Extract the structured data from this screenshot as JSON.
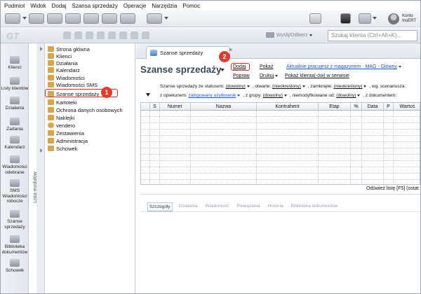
{
  "menubar": [
    "Podmiot",
    "Widok",
    "Dodaj",
    "Szansa sprzedaży",
    "Operacje",
    "Narzędzia",
    "Pomoc"
  ],
  "account": {
    "line1": "Konto",
    "line2": "InsERT"
  },
  "toolbar": {
    "send_label": "Wyślij/Odbierz",
    "search_placeholder": "Szukaj klienta (Ctrl+Alt+K)..."
  },
  "rail": {
    "items": [
      "Klienci",
      "Listy klientów",
      "Działania",
      "Zadania",
      "Kalendarz",
      "Wiadomości odebrane",
      "SMS Wiadomości robocze",
      "Szanse sprzedaży",
      "Biblioteka dokumentów",
      "Schowek"
    ],
    "vertical_label": "Lista modułów"
  },
  "tree": {
    "items": [
      "Strona główna",
      "Klienci",
      "Działania",
      "Kalendarz",
      "Wiadomości",
      "Wiadomości SMS",
      "Szanse sprzedaży",
      "Kartoteki",
      "Ochrona danych osobowych",
      "Naklejki",
      "vendero",
      "Zestawienia",
      "Administracja",
      "Schowek"
    ],
    "selected": "Szanse sprzedaży"
  },
  "tab": {
    "label": "Szanse sprzedaży",
    "close": "×"
  },
  "page": {
    "title": "Szanse sprzedaży",
    "actions": {
      "dodaj": "Dodaj",
      "pokaz": "Pokaż",
      "popraw": "Popraw",
      "drukuj": "Drukuj",
      "pokaz_klienta": "Pokaż klienta(-ów) w serwisie"
    },
    "warehouse_link": "Aktualnie pracujesz z magazynem - MAG - Główny"
  },
  "filters": {
    "status_label": "Szanse sprzedaży ze statusem:",
    "status_value": "(dowolny)",
    "otwarte_label": ", otwarte:",
    "otwarte_value": "(nieokreślony)",
    "zamkniete_label": ", zamknięte:",
    "zamkniete_value": "(nieokreślony)",
    "scenariusz_label": ", wg. scenariusza:",
    "opiekun_label": "z opiekunem:",
    "opiekun_value": "zalogowany użytkownik",
    "grupy_label": ", z grupy:",
    "grupy_value": "(dowolny)",
    "niemod_label": ", niemodyfikowane od:",
    "niemod_value": "(dowolny)",
    "dokument_label": ", z dokumentem:"
  },
  "grid": {
    "columns": [
      "",
      "S",
      "Numer",
      "Nazwa",
      "Kontrahent",
      "Etap",
      "%",
      "Data",
      "P",
      "Wartoś"
    ]
  },
  "refresh_label": "Odśwież listę [F5] (ostat",
  "details_tabs": [
    "Szczegóły",
    "Działania",
    "Wiadomość",
    "Powiązania",
    "Historia",
    "Biblioteka dokumentów"
  ],
  "badges": {
    "one": "1",
    "two": "2"
  },
  "colors": {
    "annotation_red": "#e23a2b",
    "link_blue": "#1a55c9",
    "title_gray": "#3d4a5a"
  }
}
